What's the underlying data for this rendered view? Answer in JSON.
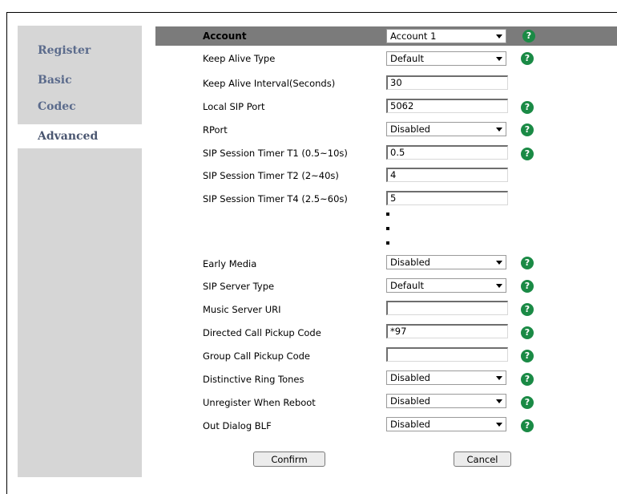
{
  "sidebar": {
    "items": [
      {
        "label": "Register",
        "active": false
      },
      {
        "label": "Basic",
        "active": false
      },
      {
        "label": "Codec",
        "active": false
      },
      {
        "label": "Advanced",
        "active": true
      }
    ]
  },
  "header": {
    "label": "Account",
    "select_value": "Account 1"
  },
  "rows": [
    {
      "label": "Keep Alive Type",
      "type": "select",
      "value": "Default",
      "help": true
    },
    {
      "label": "Keep Alive Interval(Seconds)",
      "type": "text",
      "value": "30",
      "help": false
    },
    {
      "label": "Local SIP Port",
      "type": "text",
      "value": "5062",
      "help": true
    },
    {
      "label": "RPort",
      "type": "select",
      "value": "Disabled",
      "help": true
    },
    {
      "label": "SIP Session Timer T1 (0.5~10s)",
      "type": "text",
      "value": "0.5",
      "help": true
    },
    {
      "label": "SIP Session Timer T2 (2~40s)",
      "type": "text",
      "value": "4",
      "help": false
    },
    {
      "label": "SIP Session Timer T4 (2.5~60s)",
      "type": "text",
      "value": "5",
      "help": false
    },
    {
      "label": "Early Media",
      "type": "select",
      "value": "Disabled",
      "help": true
    },
    {
      "label": "SIP Server Type",
      "type": "select",
      "value": "Default",
      "help": true
    },
    {
      "label": "Music Server URI",
      "type": "text",
      "value": "",
      "help": true
    },
    {
      "label": "Directed Call Pickup Code",
      "type": "text",
      "value": "*97",
      "help": true
    },
    {
      "label": "Group Call Pickup Code",
      "type": "text",
      "value": "",
      "help": true
    },
    {
      "label": "Distinctive Ring Tones",
      "type": "select",
      "value": "Disabled",
      "help": true
    },
    {
      "label": "Unregister When Reboot",
      "type": "select",
      "value": "Disabled",
      "help": true
    },
    {
      "label": "Out Dialog BLF",
      "type": "select",
      "value": "Disabled",
      "help": true
    }
  ],
  "help_glyph": "?",
  "buttons": {
    "confirm": "Confirm",
    "cancel": "Cancel"
  },
  "colors": {
    "sidebar_bg": "#d6d6d6",
    "header_bg": "#7b7b7b",
    "help_icon": "#1a8a45",
    "sidebar_text": "#5b6b8c"
  }
}
